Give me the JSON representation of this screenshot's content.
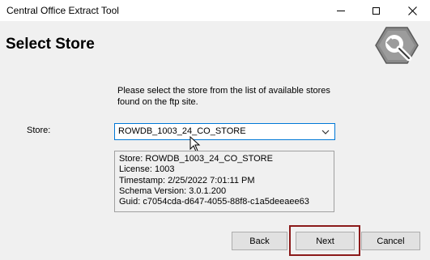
{
  "window": {
    "title": "Central Office Extract Tool",
    "minimize_glyph": "",
    "close_glyph": "✕"
  },
  "header": {
    "page_title": "Select Store",
    "logo_icon": "wrench-gear-icon"
  },
  "main": {
    "instructions_line1": "Please select the store from the list of available stores",
    "instructions_line2": "found on the ftp site.",
    "store_label": "Store:",
    "store_selected": "ROWDB_1003_24_CO_STORE",
    "details": [
      "Store: ROWDB_1003_24_CO_STORE",
      "License: 1003",
      "Timestamp: 2/25/2022 7:01:11 PM",
      "Schema Version: 3.0.1.200",
      "Guid: c7054cda-d647-4055-88f8-c1a5deeaee63"
    ]
  },
  "footer": {
    "back_label": "Back",
    "next_label": "Next",
    "cancel_label": "Cancel"
  },
  "colors": {
    "background": "#f0f0f0",
    "titlebar": "#ffffff",
    "select_border": "#0078d7",
    "highlight": "#8b1a1a"
  }
}
